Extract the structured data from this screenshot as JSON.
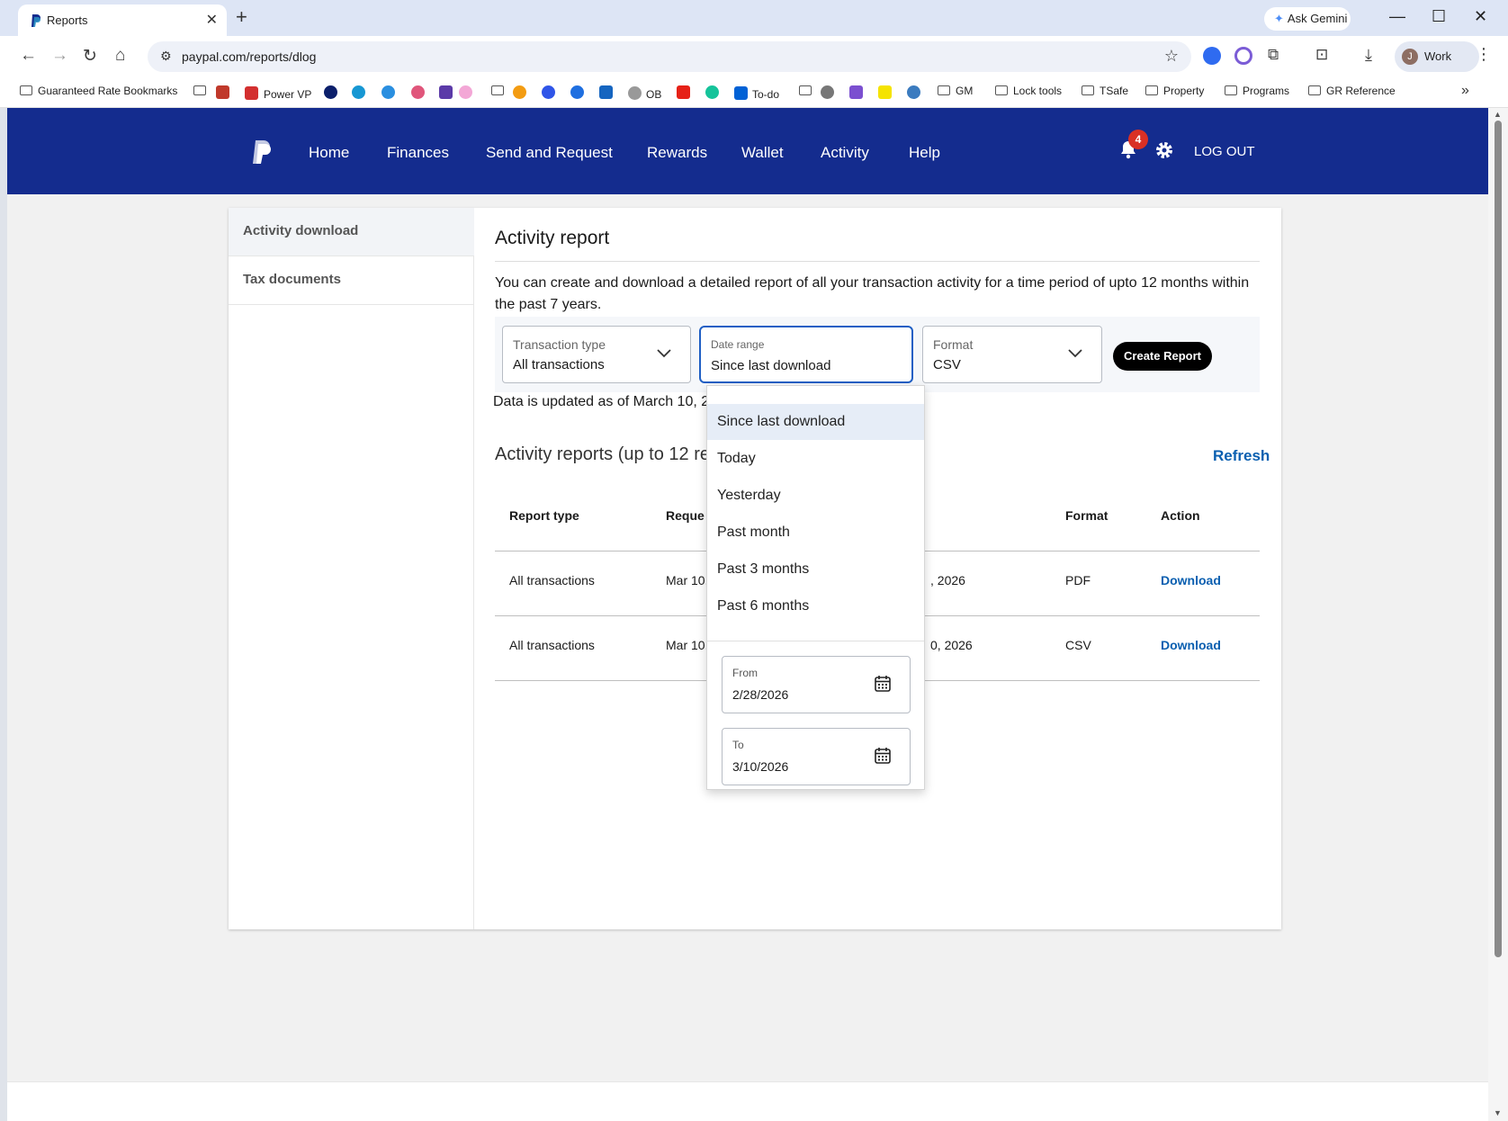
{
  "browser": {
    "tab_title": "Reports",
    "url": "paypal.com/reports/dlog",
    "ask_gemini": "Ask Gemini",
    "profile_initial": "J",
    "profile_name": "Work",
    "bookmarks": [
      "Guaranteed Rate Bookmarks",
      "Power VP",
      "OB",
      "To-do",
      "GM",
      "Lock tools",
      "TSafe",
      "Property",
      "Programs",
      "GR Reference"
    ]
  },
  "header": {
    "nav": [
      "Home",
      "Finances",
      "Send and Request",
      "Rewards",
      "Wallet",
      "Activity",
      "Help"
    ],
    "notification_count": "4",
    "logout": "LOG OUT"
  },
  "sidebar": {
    "items": [
      {
        "label": "Activity download",
        "active": true
      },
      {
        "label": "Tax documents",
        "active": false
      }
    ]
  },
  "report": {
    "title": "Activity report",
    "description": "You can create and download a detailed report of all your transaction activity for a time period of upto 12 months within the past 7 years.",
    "transaction_type_label": "Transaction type",
    "transaction_type_value": "All transactions",
    "date_range_label": "Date range",
    "date_range_value": "Since last download",
    "format_label": "Format",
    "format_value": "CSV",
    "create_button": "Create Report",
    "updated_text": "Data is updated as of March 10, 2"
  },
  "reports_list": {
    "title": "Activity reports (up to 12 re",
    "refresh": "Refresh",
    "headers": [
      "Report type",
      "Reque",
      "Format",
      "Action"
    ],
    "rows": [
      {
        "type": "All transactions",
        "requested": "Mar 10,",
        "range_end": ", 2026",
        "format": "PDF",
        "action": "Download"
      },
      {
        "type": "All transactions",
        "requested": "Mar 10,",
        "range_end": "0, 2026",
        "format": "CSV",
        "action": "Download"
      }
    ]
  },
  "date_dropdown": {
    "options": [
      "Since last download",
      "Today",
      "Yesterday",
      "Past month",
      "Past 3 months",
      "Past 6 months"
    ],
    "selected_index": 0,
    "from_label": "From",
    "from_value": "2/28/2026",
    "to_label": "To",
    "to_value": "3/10/2026"
  },
  "colors": {
    "paypal_header": "#142c8e",
    "link_blue": "#0a5fb0",
    "focus_blue": "#1f5fc4",
    "badge_red": "#d93025"
  }
}
